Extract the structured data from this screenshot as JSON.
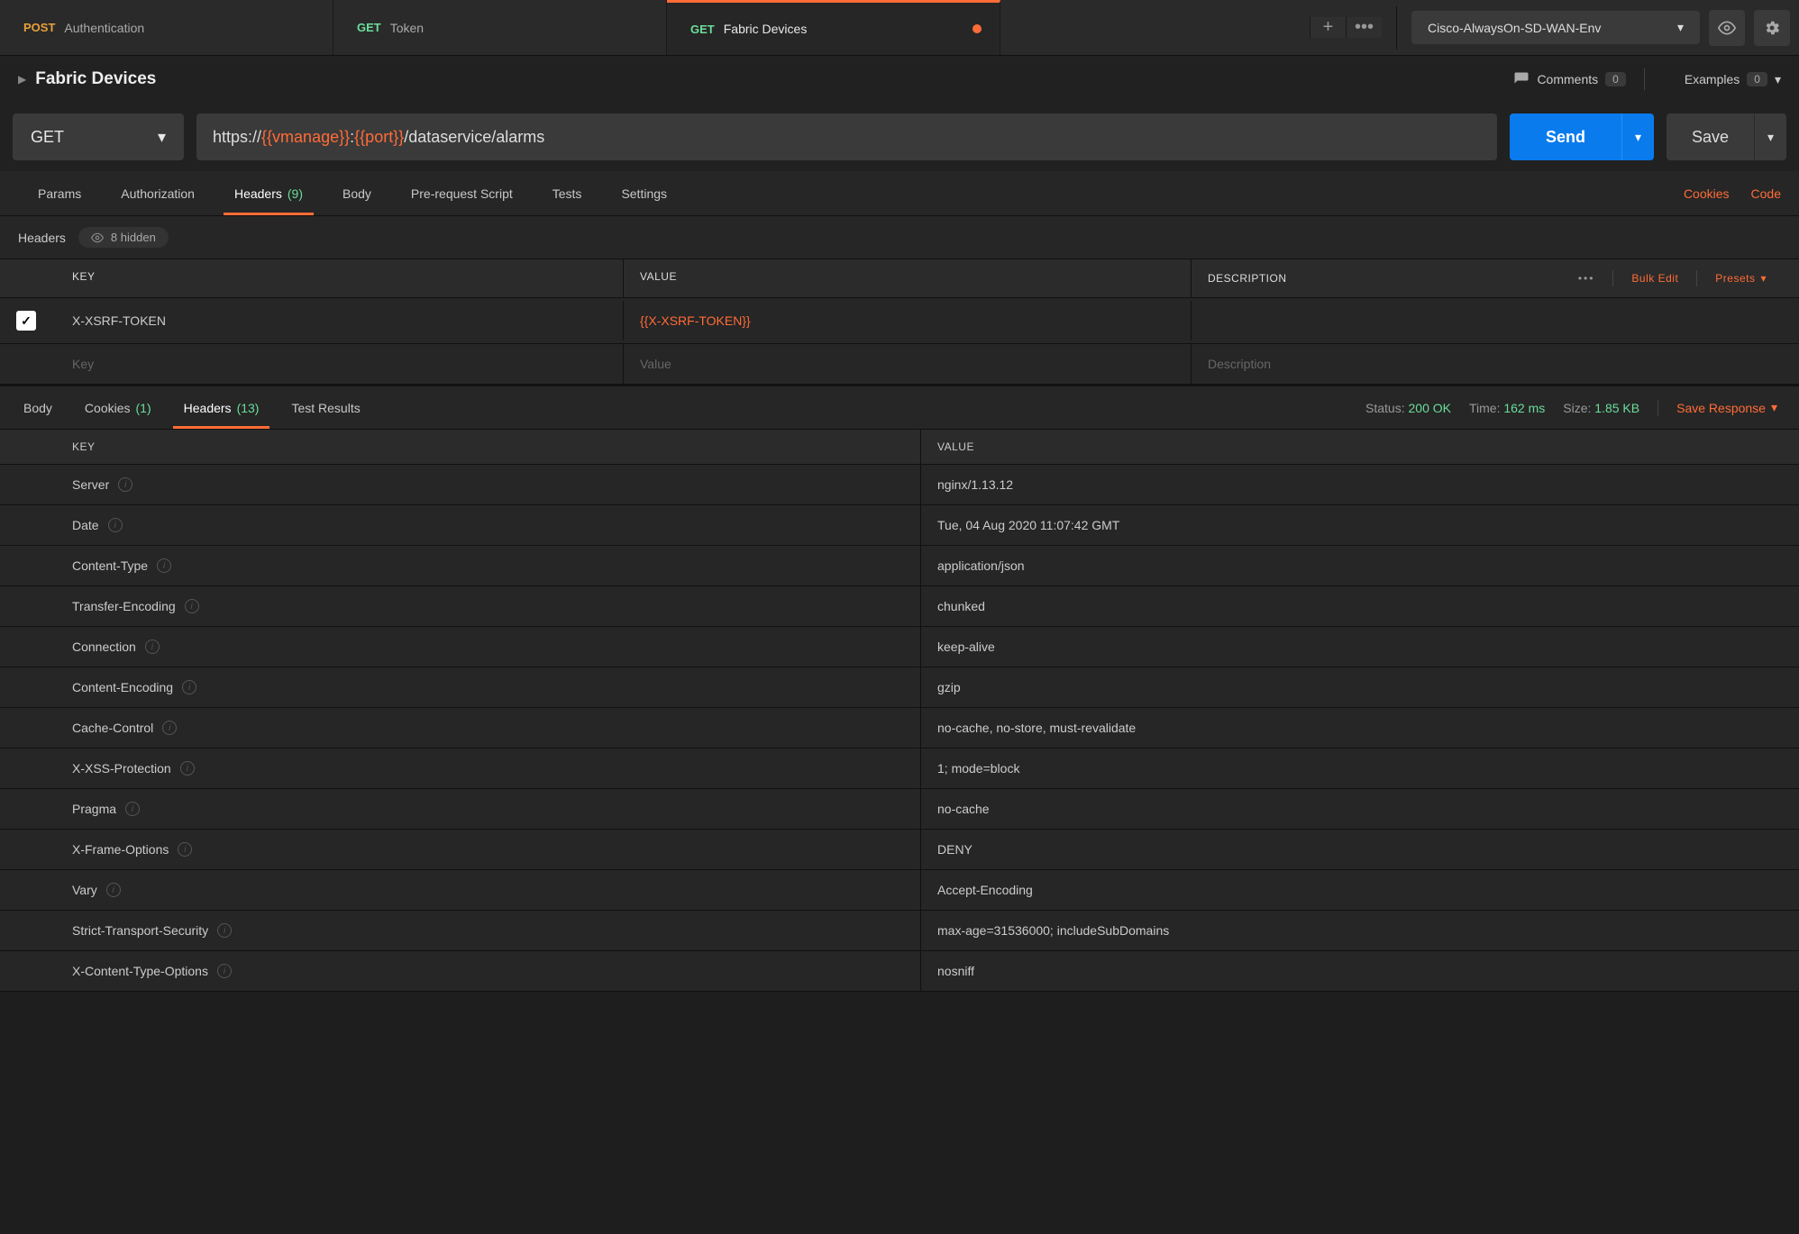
{
  "tabs": [
    {
      "method": "POST",
      "label": "Authentication",
      "methodClass": "method-post"
    },
    {
      "method": "GET",
      "label": "Token",
      "methodClass": "method-get"
    },
    {
      "method": "GET",
      "label": "Fabric Devices",
      "methodClass": "method-get",
      "active": true,
      "dirty": true
    }
  ],
  "environment": "Cisco-AlwaysOn-SD-WAN-Env",
  "requestTitle": "Fabric Devices",
  "comments": {
    "label": "Comments",
    "count": "0"
  },
  "examples": {
    "label": "Examples",
    "count": "0"
  },
  "method": "GET",
  "url_prefix": "https://",
  "url_var1": "{{vmanage}}",
  "url_colon": ":",
  "url_var2": "{{port}}",
  "url_path": "/dataservice/alarms",
  "sendLabel": "Send",
  "saveLabel": "Save",
  "reqTabs": {
    "params": "Params",
    "auth": "Authorization",
    "headers": "Headers",
    "headersCount": "(9)",
    "body": "Body",
    "prereq": "Pre-request Script",
    "tests": "Tests",
    "settings": "Settings",
    "cookies": "Cookies",
    "code": "Code"
  },
  "headersSection": {
    "title": "Headers",
    "hidden": "8 hidden"
  },
  "reqTableHeader": {
    "key": "KEY",
    "value": "VALUE",
    "description": "DESCRIPTION",
    "bulk": "Bulk Edit",
    "presets": "Presets"
  },
  "reqHeaders": [
    {
      "key": "X-XSRF-TOKEN",
      "value": "{{X-XSRF-TOKEN}}"
    }
  ],
  "placeholders": {
    "key": "Key",
    "value": "Value",
    "description": "Description"
  },
  "respTabs": {
    "body": "Body",
    "cookies": "Cookies",
    "cookiesCount": "(1)",
    "headers": "Headers",
    "headersCount": "(13)",
    "tests": "Test Results"
  },
  "status": {
    "label": "Status:",
    "value": "200 OK"
  },
  "time": {
    "label": "Time:",
    "value": "162 ms"
  },
  "size": {
    "label": "Size:",
    "value": "1.85 KB"
  },
  "saveResponse": "Save Response",
  "respTableHeader": {
    "key": "KEY",
    "value": "VALUE"
  },
  "respHeaders": [
    {
      "key": "Server",
      "value": "nginx/1.13.12"
    },
    {
      "key": "Date",
      "value": "Tue, 04 Aug 2020 11:07:42 GMT"
    },
    {
      "key": "Content-Type",
      "value": "application/json"
    },
    {
      "key": "Transfer-Encoding",
      "value": "chunked"
    },
    {
      "key": "Connection",
      "value": "keep-alive"
    },
    {
      "key": "Content-Encoding",
      "value": "gzip"
    },
    {
      "key": "Cache-Control",
      "value": "no-cache, no-store, must-revalidate"
    },
    {
      "key": "X-XSS-Protection",
      "value": "1; mode=block"
    },
    {
      "key": "Pragma",
      "value": "no-cache"
    },
    {
      "key": "X-Frame-Options",
      "value": "DENY"
    },
    {
      "key": "Vary",
      "value": "Accept-Encoding"
    },
    {
      "key": "Strict-Transport-Security",
      "value": "max-age=31536000; includeSubDomains"
    },
    {
      "key": "X-Content-Type-Options",
      "value": "nosniff"
    }
  ]
}
